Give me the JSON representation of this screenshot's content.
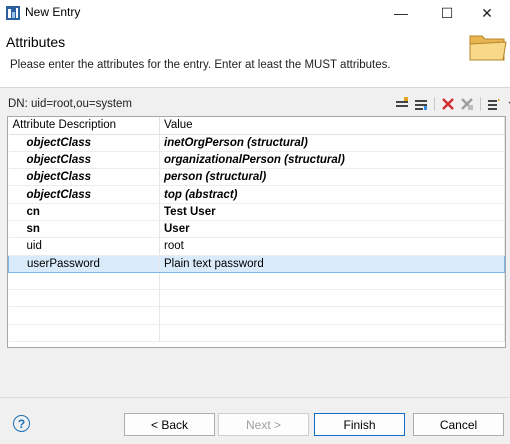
{
  "window": {
    "title": "New Entry",
    "minimize_glyph": "—",
    "maximize_glyph": "☐",
    "close_glyph": "✕"
  },
  "header": {
    "title": "Attributes",
    "description": "Please enter the attributes for the entry. Enter at least the MUST attributes."
  },
  "dn": "DN: uid=root,ou=system",
  "toolbar": {
    "icons": [
      "new-attribute-icon",
      "new-value-icon",
      "delete-icon",
      "delete-all-icon",
      "filter-icon",
      "view-menu-icon"
    ]
  },
  "table": {
    "columns": [
      "Attribute Description",
      "Value"
    ],
    "rows": [
      {
        "attribute": "objectClass",
        "value": "inetOrgPerson (structural)",
        "kind": "oc"
      },
      {
        "attribute": "objectClass",
        "value": "organizationalPerson (structural)",
        "kind": "oc"
      },
      {
        "attribute": "objectClass",
        "value": "person (structural)",
        "kind": "oc"
      },
      {
        "attribute": "objectClass",
        "value": "top (abstract)",
        "kind": "oc"
      },
      {
        "attribute": "cn",
        "value": "Test User",
        "kind": "must"
      },
      {
        "attribute": "sn",
        "value": "User",
        "kind": "must"
      },
      {
        "attribute": "uid",
        "value": "root",
        "kind": "may"
      },
      {
        "attribute": "userPassword",
        "value": "Plain text password",
        "kind": "selected"
      }
    ]
  },
  "buttons": {
    "help": "?",
    "back": "< Back",
    "next": "Next >",
    "finish": "Finish",
    "cancel": "Cancel"
  },
  "colors": {
    "selection": "#d9ebfb",
    "accent": "#0f6ec9"
  }
}
